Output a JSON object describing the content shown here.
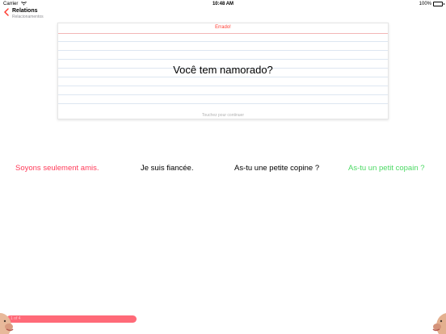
{
  "status_bar": {
    "carrier": "Carrier",
    "time": "10:48 AM",
    "battery_text": "100%"
  },
  "nav": {
    "title": "Relations",
    "subtitle": "Relacionamentos",
    "back_icon": "chevron-left-icon"
  },
  "card": {
    "status": "Errado!",
    "prompt": "Você tem namorado?",
    "hint": "Touchez pour continuer"
  },
  "answers": [
    {
      "label": "Soyons seulement amis.",
      "state": "incorrect",
      "color": "#ff3b59"
    },
    {
      "label": "Je suis fiancée.",
      "state": "neutral",
      "color": "#000000"
    },
    {
      "label": "As-tu une petite copine ?",
      "state": "neutral",
      "color": "#000000"
    },
    {
      "label": "As-tu un petit copain ?",
      "state": "correct",
      "color": "#4cd964"
    }
  ],
  "progress": {
    "label": "1 of 4",
    "fraction": 0.3
  },
  "colors": {
    "accent": "#ff3b30",
    "wrong": "#ff3b59",
    "right": "#4cd964",
    "progress": "#ff6a78"
  }
}
